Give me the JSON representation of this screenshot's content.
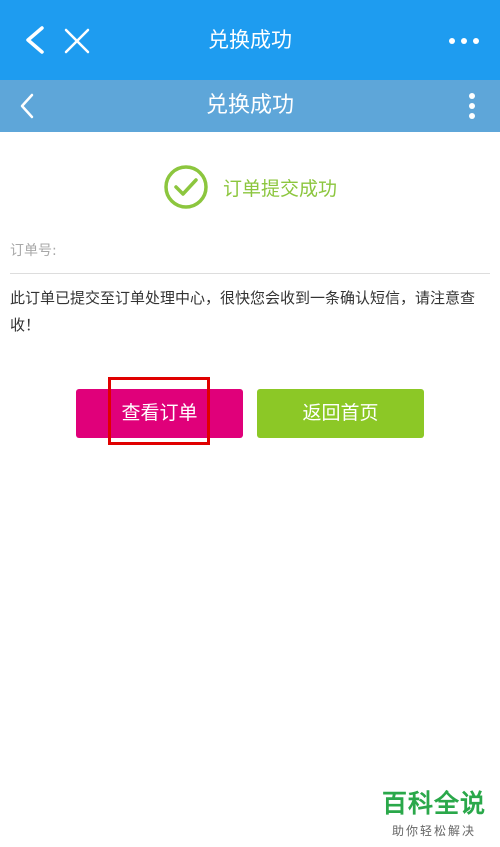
{
  "topbar": {
    "title": "兑换成功"
  },
  "subbar": {
    "title": "兑换成功"
  },
  "success": {
    "message": "订单提交成功",
    "color": "#8cc63e"
  },
  "order": {
    "label": "订单号:"
  },
  "notice": {
    "text": "此订单已提交至订单处理中心，很快您会收到一条确认短信，请注意查收！"
  },
  "buttons": {
    "view_order": "查看订单",
    "back_home": "返回首页"
  },
  "watermark": {
    "title": "百科全说",
    "subtitle": "助你轻松解决"
  },
  "colors": {
    "topbar": "#1e9cf0",
    "subbar": "#5ea6d9",
    "view_button": "#e0007a",
    "home_button": "#8cc826",
    "highlight": "#e00000"
  },
  "icons": [
    "back-icon",
    "close-icon",
    "more-icon",
    "menu-icon",
    "check-icon"
  ]
}
